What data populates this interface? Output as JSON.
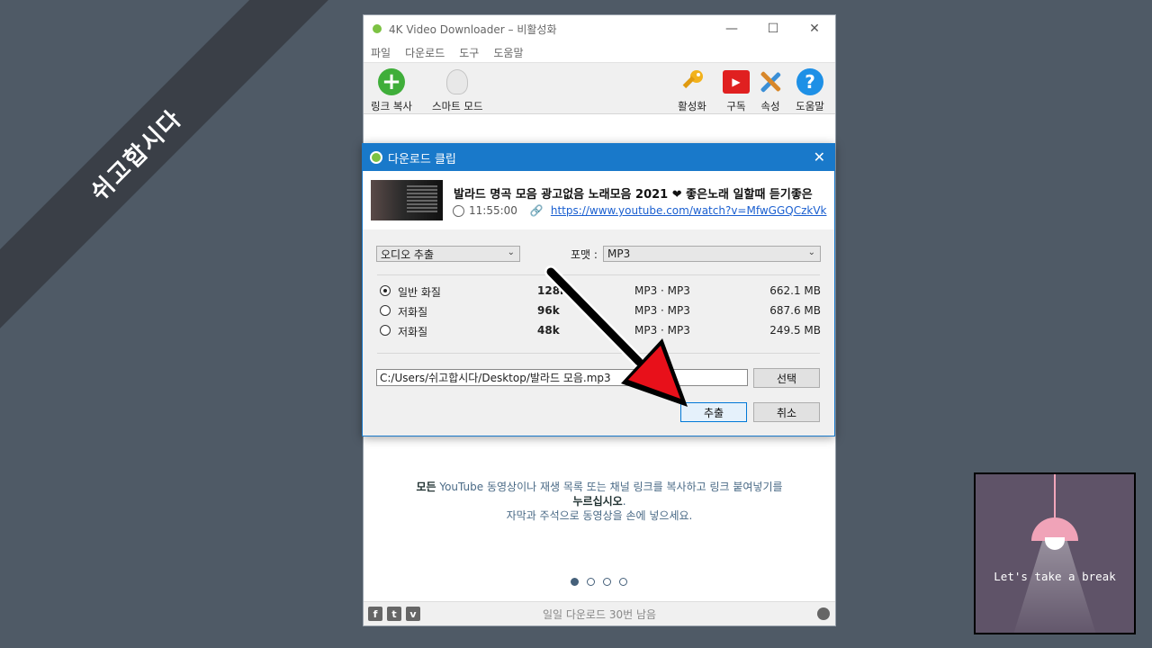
{
  "banner": {
    "text": "쉬고합시다"
  },
  "window": {
    "title": "4K Video Downloader – 비활성화",
    "menu": [
      "파일",
      "다운로드",
      "도구",
      "도움말"
    ],
    "toolbar": {
      "paste_link": "링크 복사",
      "smart_mode": "스마트 모드",
      "activate": "활성화",
      "subscribe": "구독",
      "preferences": "속성",
      "help": "도움말"
    },
    "promo": {
      "line1_bold": "모든",
      "line1_rest": " YouTube 동영상이나 재생 목록 또는 채널 링크를 복사하고 링크 붙여넣기를",
      "line2_bold": "누르십시오",
      "line2_rest": ".",
      "line3": "자막과 주석으로 동영상을 손에 넣으세요."
    },
    "footer": {
      "remaining": "일일 다운로드 30번 남음"
    }
  },
  "dialog": {
    "title": "다운로드 클립",
    "video": {
      "title": "발라드 명곡 모음 광고없음 노래모음 2021 ❤ 좋은노래 일할때 듣기좋은",
      "duration": "11:55:00",
      "url": "https://www.youtube.com/watch?v=MfwGGQCzkVk"
    },
    "mode_select": "오디오 추출",
    "format_label": "포맷 :",
    "format_select": "MP3",
    "options": [
      {
        "quality": "일반 화질",
        "bitrate": "128k",
        "format": "MP3 · MP3",
        "size": "662.1 MB",
        "selected": true
      },
      {
        "quality": "저화질",
        "bitrate": "96k",
        "format": "MP3 · MP3",
        "size": "687.6 MB",
        "selected": false
      },
      {
        "quality": "저화질",
        "bitrate": "48k",
        "format": "MP3 · MP3",
        "size": "249.5 MB",
        "selected": false
      }
    ],
    "path": "C:/Users/쉬고합시다/Desktop/발라드 모음.mp3",
    "choose_button": "선택",
    "extract_button": "추출",
    "cancel_button": "취소"
  },
  "break_box": {
    "text": "Let's take a break"
  },
  "colors": {
    "dialog_titlebar": "#1979ca",
    "background": "#4f5a66",
    "arrow": "#e8101a"
  }
}
